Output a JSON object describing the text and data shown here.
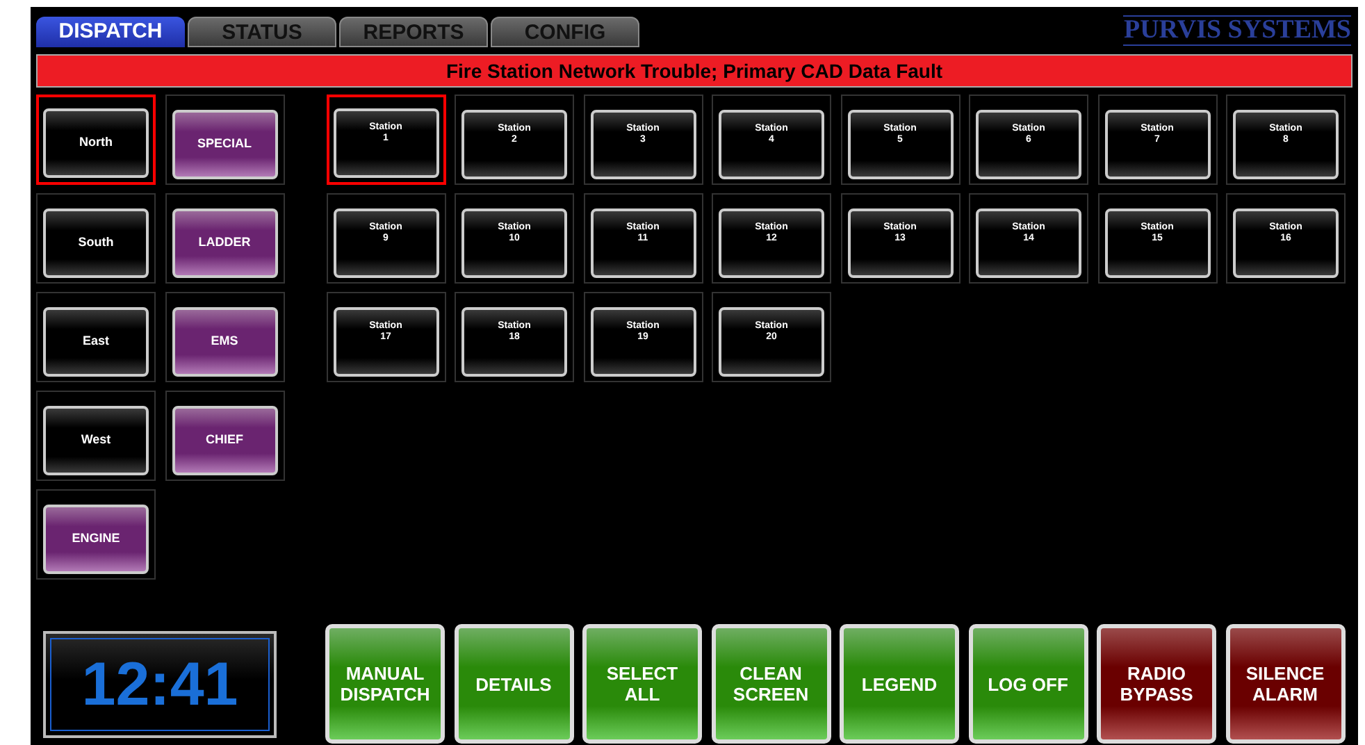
{
  "tabs": [
    {
      "label": "DISPATCH",
      "selected": true
    },
    {
      "label": "STATUS",
      "selected": false
    },
    {
      "label": "REPORTS",
      "selected": false
    },
    {
      "label": "CONFIG",
      "selected": false
    }
  ],
  "logo": "PURVIS SYSTEMS",
  "alert": "Fire Station Network Trouble; Primary CAD Data Fault",
  "groups": [
    {
      "label": "North",
      "kind": "region",
      "selected": true
    },
    {
      "label": "SPECIAL",
      "kind": "apparatus",
      "selected": false
    },
    {
      "label": "South",
      "kind": "region",
      "selected": false
    },
    {
      "label": "LADDER",
      "kind": "apparatus",
      "selected": false
    },
    {
      "label": "East",
      "kind": "region",
      "selected": false
    },
    {
      "label": "EMS",
      "kind": "apparatus",
      "selected": false
    },
    {
      "label": "West",
      "kind": "region",
      "selected": false
    },
    {
      "label": "CHIEF",
      "kind": "apparatus",
      "selected": false
    },
    {
      "label": "ENGINE",
      "kind": "apparatus",
      "selected": false
    }
  ],
  "stations": [
    {
      "label": "Station",
      "number": "1",
      "selected": true
    },
    {
      "label": "Station",
      "number": "2",
      "selected": false
    },
    {
      "label": "Station",
      "number": "3",
      "selected": false
    },
    {
      "label": "Station",
      "number": "4",
      "selected": false
    },
    {
      "label": "Station",
      "number": "5",
      "selected": false
    },
    {
      "label": "Station",
      "number": "6",
      "selected": false
    },
    {
      "label": "Station",
      "number": "7",
      "selected": false
    },
    {
      "label": "Station",
      "number": "8",
      "selected": false
    },
    {
      "label": "Station",
      "number": "9",
      "selected": false
    },
    {
      "label": "Station",
      "number": "10",
      "selected": false
    },
    {
      "label": "Station",
      "number": "11",
      "selected": false
    },
    {
      "label": "Station",
      "number": "12",
      "selected": false
    },
    {
      "label": "Station",
      "number": "13",
      "selected": false
    },
    {
      "label": "Station",
      "number": "14",
      "selected": false
    },
    {
      "label": "Station",
      "number": "15",
      "selected": false
    },
    {
      "label": "Station",
      "number": "16",
      "selected": false
    },
    {
      "label": "Station",
      "number": "17",
      "selected": false
    },
    {
      "label": "Station",
      "number": "18",
      "selected": false
    },
    {
      "label": "Station",
      "number": "19",
      "selected": false
    },
    {
      "label": "Station",
      "number": "20",
      "selected": false
    }
  ],
  "clock": "12:41",
  "actions": [
    {
      "lines": [
        "MANUAL",
        "DISPATCH"
      ],
      "kind": "normal"
    },
    {
      "lines": [
        "DETAILS"
      ],
      "kind": "normal"
    },
    {
      "lines": [
        "SELECT",
        "ALL"
      ],
      "kind": "normal"
    },
    {
      "lines": [
        "CLEAN",
        "SCREEN"
      ],
      "kind": "normal"
    },
    {
      "lines": [
        "LEGEND"
      ],
      "kind": "normal"
    },
    {
      "lines": [
        "LOG OFF"
      ],
      "kind": "normal"
    },
    {
      "lines": [
        "RADIO",
        "BYPASS"
      ],
      "kind": "alarm"
    },
    {
      "lines": [
        "SILENCE",
        "ALARM"
      ],
      "kind": "alarm"
    }
  ]
}
